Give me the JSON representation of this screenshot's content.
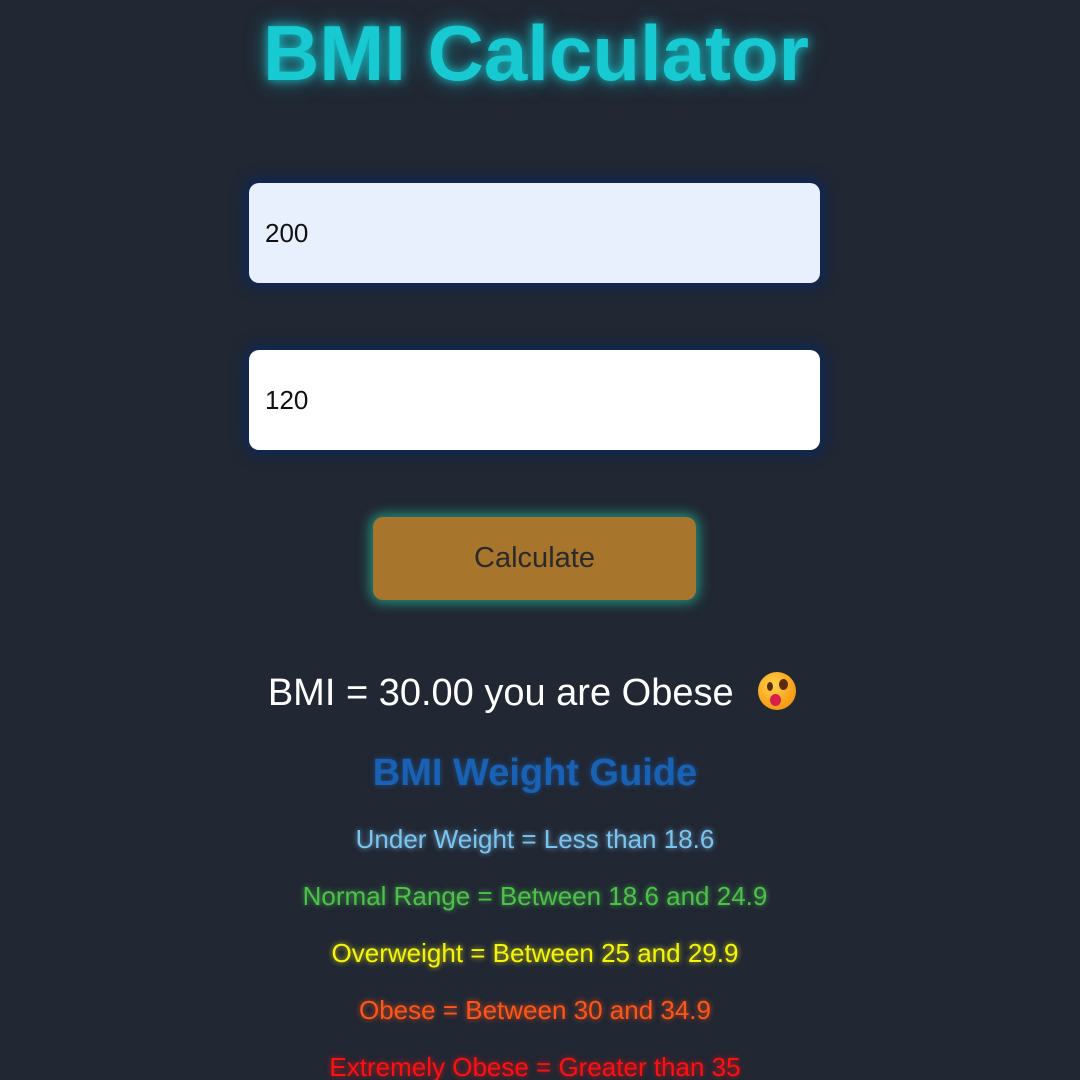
{
  "app": {
    "title": "BMI Calculator"
  },
  "form": {
    "height_value": "200",
    "weight_value": "120",
    "calculate_label": "Calculate"
  },
  "result": {
    "text": "BMI = 30.00 you are Obese",
    "emoji": "astonished-face-icon"
  },
  "guide": {
    "title": "BMI Weight Guide",
    "items": [
      "Under Weight = Less than 18.6",
      "Normal Range = Between 18.6 and 24.9",
      "Overweight = Between 25 and 29.9",
      "Obese = Between 30 and 34.9",
      "Extremely Obese = Greater than 35"
    ]
  },
  "colors": {
    "background": "#212733",
    "title": "#17c9d0",
    "button": "#a8752d",
    "guide_title": "#1961b4",
    "under_weight": "#7cc4f0",
    "normal": "#4cc24a",
    "overweight": "#f5f50a",
    "obese": "#ff5518",
    "extremely_obese": "#ff1010"
  }
}
